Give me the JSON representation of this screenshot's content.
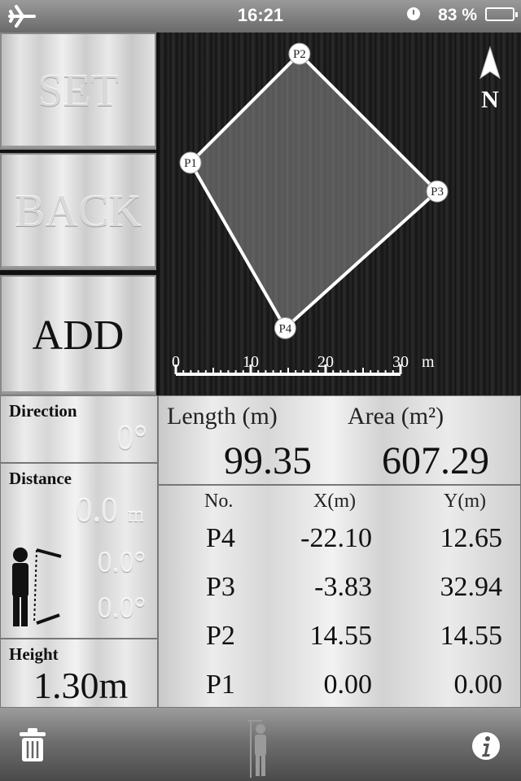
{
  "status_bar": {
    "time": "16:21",
    "battery_percent": "83 %",
    "icons": [
      "airplane-icon",
      "clock-icon",
      "battery-icon"
    ]
  },
  "buttons": {
    "set": "SET",
    "back": "BACK",
    "add": "ADD"
  },
  "map": {
    "compass_label": "N",
    "points": [
      {
        "label": "P1",
        "x": 0.0,
        "y": 0.0
      },
      {
        "label": "P2",
        "x": 14.55,
        "y": 14.55
      },
      {
        "label": "P3",
        "x": -3.83,
        "y": 32.94
      },
      {
        "label": "P4",
        "x": -22.1,
        "y": 12.65
      }
    ],
    "scale_labels": [
      "0",
      "10",
      "20",
      "30"
    ],
    "scale_unit": "m"
  },
  "direction": {
    "label": "Direction",
    "value": "0°"
  },
  "distance": {
    "label": "Distance",
    "value": "0.0",
    "unit": "m",
    "angle1": "0.0°",
    "angle2": "0.0°"
  },
  "height": {
    "label": "Height",
    "value": "1.30m"
  },
  "summary": {
    "length_label": "Length (m)",
    "length_value": "99.35",
    "area_label": "Area (m²)",
    "area_value": "607.29"
  },
  "table": {
    "headers": [
      "No.",
      "X(m)",
      "Y(m)"
    ],
    "rows": [
      {
        "no": "P4",
        "x": "-22.10",
        "y": "12.65"
      },
      {
        "no": "P3",
        "x": "-3.83",
        "y": "32.94"
      },
      {
        "no": "P2",
        "x": "14.55",
        "y": "14.55"
      },
      {
        "no": "P1",
        "x": "0.00",
        "y": "0.00"
      }
    ]
  },
  "toolbar": {
    "icons": [
      "trash-icon",
      "person-height-icon",
      "info-icon"
    ]
  }
}
